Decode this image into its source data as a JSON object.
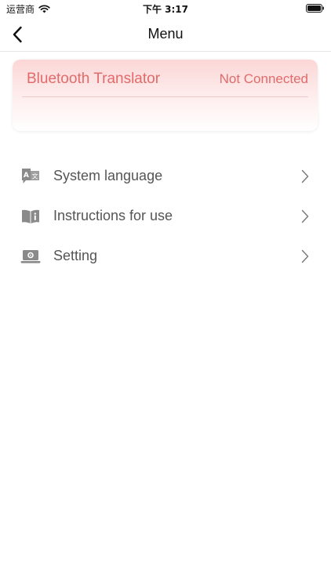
{
  "status_bar": {
    "carrier": "运营商",
    "time": "下午 3:17"
  },
  "nav": {
    "title": "Menu"
  },
  "device": {
    "name": "Bluetooth Translator",
    "status": "Not Connected",
    "accent_color": "#e36a6a"
  },
  "menu": {
    "items": [
      {
        "label": "System language",
        "icon": "translate-icon"
      },
      {
        "label": "Instructions for use",
        "icon": "book-info-icon"
      },
      {
        "label": "Setting",
        "icon": "laptop-settings-icon"
      }
    ]
  }
}
